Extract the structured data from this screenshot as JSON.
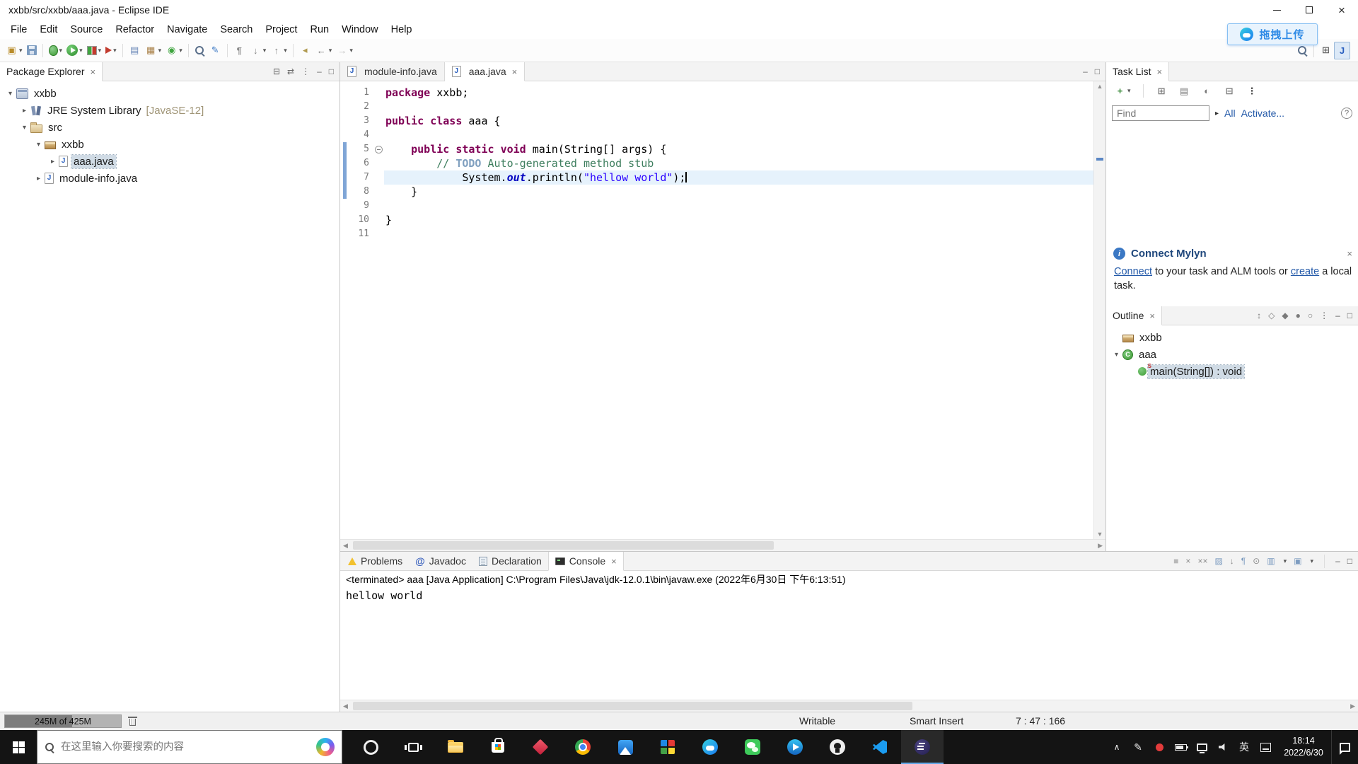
{
  "window": {
    "title": "xxbb/src/xxbb/aaa.java - Eclipse IDE"
  },
  "menubar": {
    "items": [
      "File",
      "Edit",
      "Source",
      "Refactor",
      "Navigate",
      "Search",
      "Project",
      "Run",
      "Window",
      "Help"
    ]
  },
  "overlay": {
    "label": "拖拽上传"
  },
  "toolbar": {
    "left": [
      {
        "n": "new-wizard",
        "g": "▣",
        "c": "#b98c2a",
        "caret": true
      },
      {
        "n": "save",
        "art": "save"
      },
      {
        "sep": true
      },
      {
        "n": "debug",
        "art": "bug",
        "caret": true
      },
      {
        "n": "run",
        "art": "run",
        "caret": true
      },
      {
        "n": "coverage",
        "art": "coverage",
        "caret": true
      },
      {
        "n": "run-external-tools",
        "art": "ext",
        "caret": true
      },
      {
        "sep": true
      },
      {
        "n": "new-java-project",
        "g": "▤",
        "c": "#6a87b8"
      },
      {
        "n": "new-package",
        "g": "▦",
        "c": "#a87f46",
        "caret": true
      },
      {
        "n": "new-class",
        "g": "◉",
        "c": "#3fa53f",
        "caret": true
      },
      {
        "sep": true
      },
      {
        "n": "java-search",
        "art": "mag"
      },
      {
        "n": "mark-occurrences",
        "g": "✎",
        "c": "#3b78c4"
      },
      {
        "sep": true
      },
      {
        "n": "show-whitespace",
        "g": "¶",
        "c": "#8a8a8a"
      },
      {
        "n": "next-annotation",
        "g": "↓",
        "c": "#8a8a8a",
        "caret": true
      },
      {
        "n": "previous-annotation",
        "g": "↑",
        "c": "#8a8a8a",
        "caret": true
      },
      {
        "sep": true
      },
      {
        "n": "last-edit-location",
        "g": "◂",
        "c": "#b09a50"
      },
      {
        "n": "back",
        "g": "←",
        "c": "#777777",
        "caret": true
      },
      {
        "n": "forward",
        "g": "→",
        "c": "#bbbbbb",
        "caret": true
      }
    ],
    "right": [
      {
        "n": "quick-access-search",
        "art": "mag"
      },
      {
        "sep": true
      },
      {
        "n": "open-perspective",
        "g": "⊞",
        "c": "#666666"
      },
      {
        "n": "java-perspective",
        "g": "J",
        "c": "#2a5fbf",
        "active": true
      }
    ]
  },
  "package_explorer": {
    "title": "Package Explorer",
    "header_icons": [
      {
        "n": "collapse-all",
        "g": "⊟"
      },
      {
        "n": "link-with-editor",
        "g": "⇄"
      },
      {
        "n": "view-menu",
        "g": "⋮"
      },
      {
        "n": "minimize-view",
        "g": "–"
      },
      {
        "n": "maximize-view",
        "g": "□"
      }
    ],
    "items": [
      {
        "indent": 0,
        "arrow": "expanded",
        "icon": "project",
        "label": "xxbb"
      },
      {
        "indent": 1,
        "arrow": "collapsed",
        "icon": "library",
        "label": "JRE System Library",
        "suffix": "[JavaSE-12]"
      },
      {
        "indent": 1,
        "arrow": "expanded",
        "icon": "src",
        "label": "src"
      },
      {
        "indent": 2,
        "arrow": "expanded",
        "icon": "package",
        "label": "xxbb"
      },
      {
        "indent": 3,
        "arrow": "collapsed",
        "icon": "jfile",
        "label": "aaa.java",
        "selected": true
      },
      {
        "indent": 2,
        "arrow": "collapsed",
        "icon": "jfile",
        "label": "module-info.java"
      }
    ]
  },
  "editor": {
    "tabs": [
      {
        "label": "module-info.java",
        "icon": "jfile",
        "active": false,
        "closable": false
      },
      {
        "label": "aaa.java",
        "icon": "jfile",
        "active": true,
        "closable": true
      }
    ],
    "header_icons": [
      {
        "n": "minimize-editor",
        "g": "–"
      },
      {
        "n": "maximize-editor",
        "g": "□"
      }
    ],
    "code": [
      {
        "n": 1,
        "t": [
          {
            "c": "kw",
            "s": "package"
          },
          {
            "c": "pl",
            "s": " xxbb;"
          }
        ]
      },
      {
        "n": 2,
        "t": []
      },
      {
        "n": 3,
        "t": [
          {
            "c": "kw",
            "s": "public"
          },
          {
            "c": "pl",
            "s": " "
          },
          {
            "c": "kw",
            "s": "class"
          },
          {
            "c": "pl",
            "s": " aaa {"
          }
        ]
      },
      {
        "n": 4,
        "t": []
      },
      {
        "n": 5,
        "fold": true,
        "t": [
          {
            "c": "pl",
            "s": "    "
          },
          {
            "c": "kw",
            "s": "public"
          },
          {
            "c": "pl",
            "s": " "
          },
          {
            "c": "kw",
            "s": "static"
          },
          {
            "c": "pl",
            "s": " "
          },
          {
            "c": "kw",
            "s": "void"
          },
          {
            "c": "pl",
            "s": " main(String[] args) {"
          }
        ]
      },
      {
        "n": 6,
        "t": [
          {
            "c": "pl",
            "s": "        "
          },
          {
            "c": "cm",
            "s": "// "
          },
          {
            "c": "todo",
            "s": "TODO"
          },
          {
            "c": "cm",
            "s": " Auto-generated method stub"
          }
        ]
      },
      {
        "n": 7,
        "current": true,
        "caret": true,
        "t": [
          {
            "c": "pl",
            "s": "            System."
          },
          {
            "c": "sf",
            "s": "out"
          },
          {
            "c": "pl",
            "s": ".println("
          },
          {
            "c": "str",
            "s": "\"hellow world\""
          },
          {
            "c": "pl",
            "s": ");"
          }
        ]
      },
      {
        "n": 8,
        "t": [
          {
            "c": "pl",
            "s": "    }"
          }
        ]
      },
      {
        "n": 9,
        "t": []
      },
      {
        "n": 10,
        "t": [
          {
            "c": "pl",
            "s": "}"
          }
        ]
      },
      {
        "n": 11,
        "t": []
      }
    ]
  },
  "task_list": {
    "title": "Task List",
    "toolbar": [
      {
        "n": "new-task",
        "g": "+",
        "c": "#3c8c3c",
        "caret": true
      },
      {
        "sep": true
      },
      {
        "n": "categorized-presentation",
        "g": "⊞",
        "c": "#7a7a7a"
      },
      {
        "n": "scheduled-presentation",
        "g": "▤",
        "c": "#7a7a7a"
      },
      {
        "n": "focus-on-workweek",
        "g": "◐",
        "c": "#7a7a7a"
      },
      {
        "n": "hide-completed",
        "g": "⊟",
        "c": "#7a7a7a"
      },
      {
        "n": "view-menu",
        "g": "⋮",
        "c": "#555555"
      }
    ],
    "find_placeholder": "Find",
    "scope_arrow": "▸",
    "link_all": "All",
    "link_activate": "Activate..."
  },
  "mylyn": {
    "title": "Connect Mylyn",
    "close": "×",
    "segments": [
      {
        "text": "Connect",
        "link": true
      },
      {
        "text": " to your task and ALM tools or ",
        "link": false
      },
      {
        "text": "create",
        "link": true
      },
      {
        "text": " a local task.",
        "link": false
      }
    ]
  },
  "outline": {
    "title": "Outline",
    "toolbar": [
      {
        "n": "sort",
        "g": "↕",
        "c": "#7a7a7a"
      },
      {
        "n": "hide-fields",
        "g": "◇",
        "c": "#7a7a7a"
      },
      {
        "n": "hide-static-members",
        "g": "◆",
        "c": "#7a7a7a"
      },
      {
        "n": "hide-non-public-members",
        "g": "●",
        "c": "#7a7a7a"
      },
      {
        "n": "hide-local-types",
        "g": "○",
        "c": "#7a7a7a"
      },
      {
        "n": "view-menu",
        "g": "⋮",
        "c": "#555555"
      },
      {
        "n": "minimize-view",
        "g": "–",
        "c": "#555555"
      },
      {
        "n": "maximize-view",
        "g": "□",
        "c": "#555555"
      }
    ],
    "items": [
      {
        "indent": 0,
        "icon": "package",
        "label": "xxbb"
      },
      {
        "indent": 0,
        "arrow": "expanded",
        "icon": "class",
        "label": "aaa"
      },
      {
        "indent": 1,
        "icon": "method",
        "label": "main(String[]) : void",
        "selected": true
      }
    ]
  },
  "console": {
    "tabs": [
      {
        "label": "Problems",
        "icon": "problems",
        "active": false,
        "closable": false
      },
      {
        "label": "Javadoc",
        "icon": "javadoc",
        "active": false,
        "closable": false
      },
      {
        "label": "Declaration",
        "icon": "declaration",
        "active": false,
        "closable": false
      },
      {
        "label": "Console",
        "icon": "console",
        "active": true,
        "closable": true
      }
    ],
    "toolbar": [
      {
        "n": "terminate",
        "g": "■",
        "c": "#b8b8b8"
      },
      {
        "n": "remove-launch",
        "g": "×",
        "c": "#8a8a8a"
      },
      {
        "n": "remove-all-terminated",
        "g": "××",
        "c": "#8a8a8a"
      },
      {
        "n": "clear-console",
        "g": "▨",
        "c": "#7d9cc0"
      },
      {
        "n": "scroll-lock",
        "g": "↓",
        "c": "#8a8a8a"
      },
      {
        "n": "word-wrap",
        "g": "¶",
        "c": "#7d9cc0"
      },
      {
        "n": "pin-console",
        "g": "⊙",
        "c": "#8a8a8a"
      },
      {
        "n": "display-selected-console",
        "g": "▥",
        "c": "#7d9cc0",
        "caret": true
      },
      {
        "n": "open-console",
        "g": "▣",
        "c": "#7d9cc0",
        "caret": true
      },
      {
        "sep": true
      },
      {
        "n": "minimize-view",
        "g": "–",
        "c": "#555555"
      },
      {
        "n": "maximize-view",
        "g": "□",
        "c": "#555555"
      }
    ],
    "label": "<terminated> aaa [Java Application] C:\\Program Files\\Java\\jdk-12.0.1\\bin\\javaw.exe (2022年6月30日 下午6:13:51)",
    "output": "hellow world"
  },
  "statusbar": {
    "heap": "245M of 425M",
    "writable": "Writable",
    "insert_mode": "Smart Insert",
    "position": "7 : 47 : 166"
  },
  "taskbar": {
    "search_placeholder": "在这里输入你要搜索的内容",
    "apps": [
      {
        "n": "opera"
      },
      {
        "n": "task-view"
      },
      {
        "n": "file-explorer"
      },
      {
        "n": "ms-store"
      },
      {
        "n": "red-diamond"
      },
      {
        "n": "chrome"
      },
      {
        "n": "blue-app"
      },
      {
        "n": "grid-app"
      },
      {
        "n": "cloud-app"
      },
      {
        "n": "wechat"
      },
      {
        "n": "video-player"
      },
      {
        "n": "github"
      },
      {
        "n": "vscode"
      },
      {
        "n": "eclipse",
        "active": true
      }
    ],
    "tray": [
      {
        "n": "hidden-icons",
        "g": "∧",
        "cls": "ti-chevron"
      },
      {
        "n": "pen-app",
        "g": "✎"
      },
      {
        "n": "red-dot-app",
        "cls": "ti-reddot"
      },
      {
        "n": "battery",
        "cls": "ti-battery"
      },
      {
        "n": "network",
        "cls": "ti-network"
      },
      {
        "n": "volume",
        "cls": "ti-volume"
      },
      {
        "n": "ime-language",
        "text": "英"
      },
      {
        "n": "ime-keyboard",
        "cls": "ti-kbd"
      }
    ],
    "clock": {
      "time": "18:14",
      "date": "2022/6/30"
    }
  }
}
